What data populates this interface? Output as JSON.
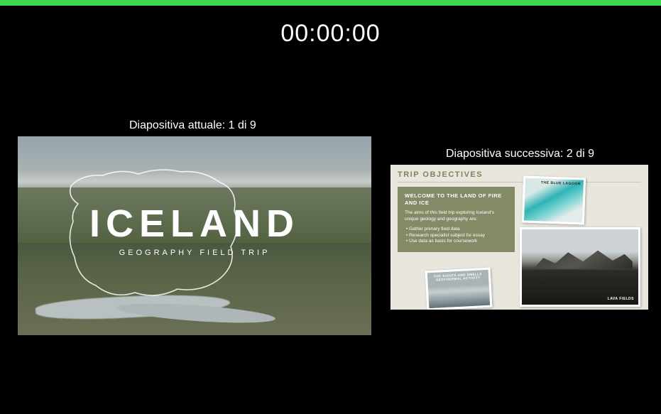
{
  "timer_value": "00:00:00",
  "current": {
    "label": "Diapositiva attuale: 1 di 9",
    "title": "ICELAND",
    "subtitle": "GEOGRAPHY FIELD TRIP"
  },
  "next": {
    "label": "Diapositiva successiva: 2 di 9",
    "heading": "TRIP OBJECTIVES",
    "panel_heading": "WELCOME TO THE LAND OF FIRE AND ICE",
    "panel_intro": "The aims of this field trip exploring Iceland's unique geology and geography are:",
    "bullets": [
      "• Gather primary field data",
      "• Research specialist subject for essay",
      "• Use data as basis for coursework"
    ],
    "photo_a_caption": "THE BLUE LAGOON",
    "photo_b_caption": "THE SIGHTS AND SMELLS GEOTHERMAL ACTIVITY",
    "photo_c_caption": "LAVA FIELDS"
  }
}
